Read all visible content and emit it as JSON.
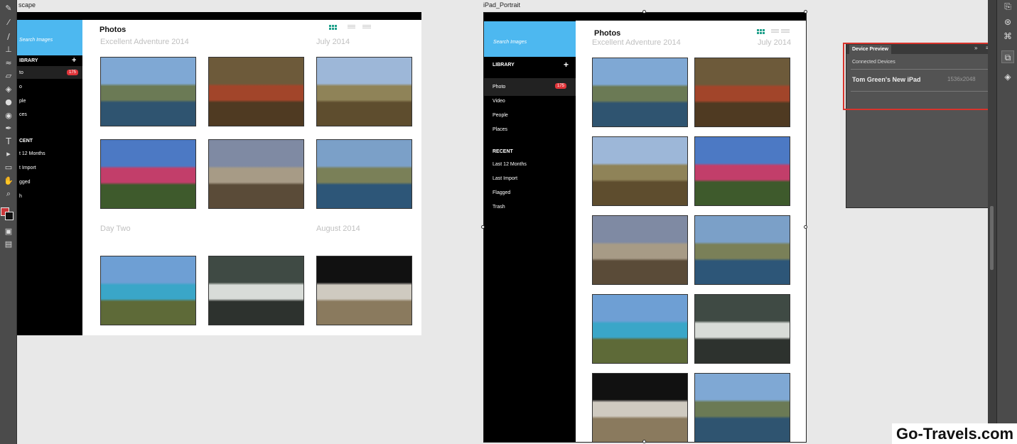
{
  "artboards": {
    "landscape_label": "scape",
    "portrait_label": "iPad_Portrait"
  },
  "app_ui": {
    "search_placeholder": "Search Images",
    "page_title": "Photos",
    "library_heading": "LIBRARY",
    "add_symbol": "+",
    "library_items": [
      "Photo",
      "Video",
      "People",
      "Places"
    ],
    "landscape_library_items": [
      "to",
      "o",
      "ple",
      "ces"
    ],
    "library_badge": "175",
    "recent_heading": "RECENT",
    "landscape_recent_heading": "CENT",
    "recent_items": [
      "Last 12 Months",
      "Last Import",
      "Flagged",
      "Trash"
    ],
    "landscape_recent_items": [
      "t 12 Months",
      "t Import",
      "gged",
      "h"
    ],
    "landscape_library_heading": "IBRARY",
    "sections": {
      "adventure": "Excellent Adventure 2014",
      "july": "July 2014",
      "day_two": "Day Two",
      "august": "August 2014"
    },
    "photos": [
      {
        "name": "coast-cliff",
        "colors": [
          "#7fa8d4",
          "#6b7a55",
          "#2f5470"
        ]
      },
      {
        "name": "madrone-bark",
        "colors": [
          "#6d5a3a",
          "#a2452a",
          "#4f3a22"
        ]
      },
      {
        "name": "private-sign",
        "colors": [
          "#9db7d8",
          "#8f8358",
          "#5e4d2e"
        ]
      },
      {
        "name": "pink-flowers",
        "colors": [
          "#4c79c4",
          "#c23e6a",
          "#3e5a2c"
        ]
      },
      {
        "name": "old-wood",
        "colors": [
          "#7f8aa3",
          "#a79b86",
          "#5a4b38"
        ]
      },
      {
        "name": "coast-bay",
        "colors": [
          "#7ba0c8",
          "#7a8058",
          "#2d5678"
        ]
      },
      {
        "name": "blue-lake",
        "colors": [
          "#6e9fd4",
          "#3aa6c8",
          "#5e6a38"
        ]
      },
      {
        "name": "surf-rocks",
        "colors": [
          "#3f4a44",
          "#d8dcd8",
          "#2d322e"
        ]
      },
      {
        "name": "chapel-window",
        "colors": [
          "#111111",
          "#cfcac0",
          "#8a7a5e"
        ]
      }
    ]
  },
  "device_preview": {
    "tab_label": "Device Preview",
    "connected_label": "Connected Devices",
    "device_name": "Tom Green's New iPad",
    "device_resolution": "1536x2048"
  },
  "watermark": "Go-Travels.com",
  "colors": {
    "accent_blue": "#4db8f0",
    "badge_red": "#e0353a",
    "view_green": "#1fa08b",
    "highlight_red": "#d8342c"
  }
}
